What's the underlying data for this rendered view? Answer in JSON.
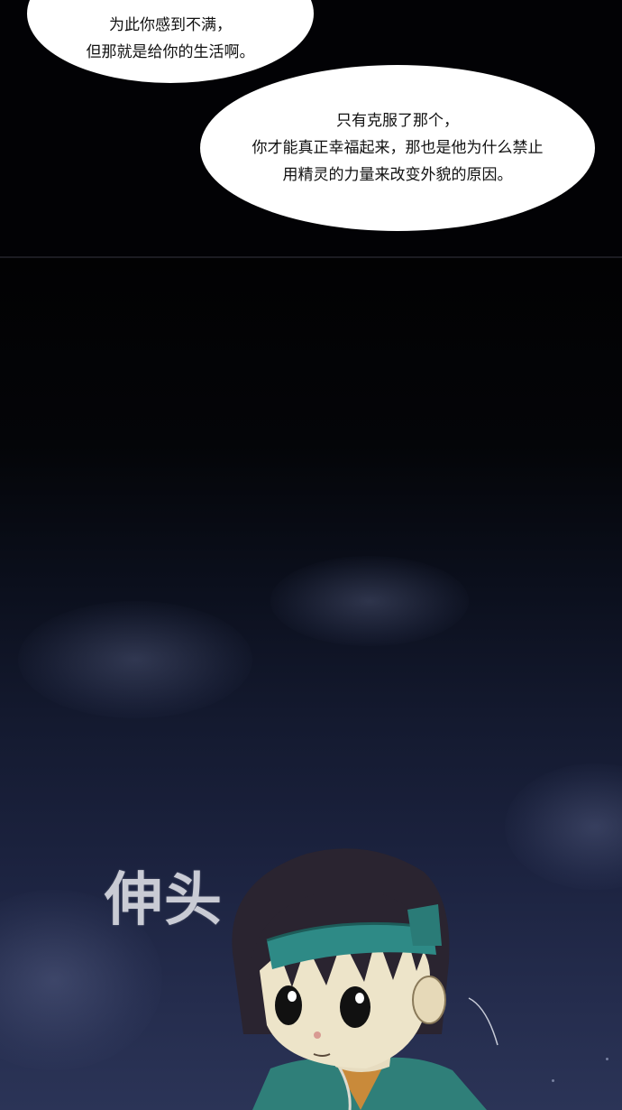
{
  "speech_bubbles": [
    {
      "lines": [
        "为此你感到不满，",
        "但那就是给你的生活啊。"
      ]
    },
    {
      "lines": [
        "只有克服了那个，",
        "你才能真正幸福起来，那也是他为什么禁止",
        "用精灵的力量来改变外貌的原因。"
      ]
    }
  ],
  "sound_effect": "伸头",
  "colors": {
    "night_top": "#020205",
    "night_bottom": "#2b3457",
    "headband": "#2e8a86",
    "hair": "#2a2430",
    "sfx_text": "#c9cbd4"
  },
  "icons": [
    "character-illustration"
  ]
}
